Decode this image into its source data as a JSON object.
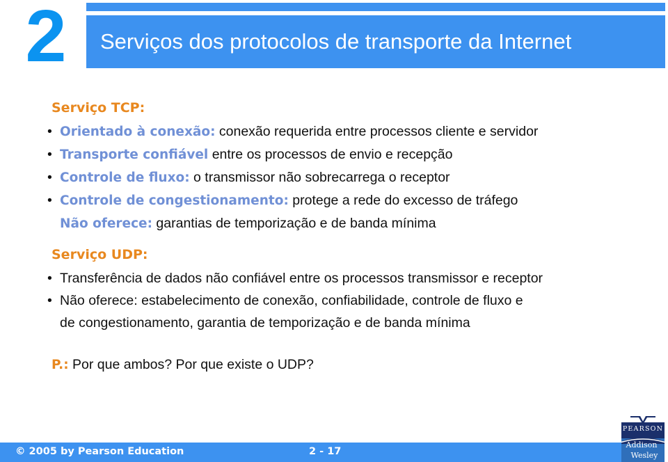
{
  "slide": {
    "chapter_number": "2",
    "title": "Serviços dos protocolos de transporte da Internet",
    "colors": {
      "banner_blue": "#3d92f0",
      "number_blue": "#0b93f0",
      "heading_orange": "#e8881f",
      "highlight_blue": "#7090d6",
      "body_black": "#101010",
      "logo_navy": "#1b2f6b",
      "logo_blue": "#2f6fba"
    }
  },
  "tcp_section": {
    "heading": "Serviço TCP:",
    "bullets": [
      {
        "marker": "•",
        "highlight": "Orientado à conexão:",
        "text": " conexão requerida entre processos cliente e servidor"
      },
      {
        "marker": "•",
        "highlight": "Transporte confiável",
        "text": " entre os processos de envio e recepção"
      },
      {
        "marker": "•",
        "highlight": "Controle de fluxo:",
        "text": " o transmissor não sobrecarrega o receptor"
      },
      {
        "marker": "•",
        "highlight": "Controle de congestionamento:",
        "text": " protege a rede do excesso de tráfego"
      }
    ],
    "subline": {
      "highlight": "Não oferece:",
      "text": " garantias de temporização e de banda mínima"
    }
  },
  "udp_section": {
    "heading": "Serviço UDP:",
    "bullets": [
      {
        "marker": "•",
        "text": "Transferência de dados não confiável entre os processos transmissor e receptor"
      },
      {
        "marker": "•",
        "text": "Não oferece: estabelecimento de conexão, confiabilidade, controle de fluxo e"
      }
    ],
    "continuation": "de congestionamento, garantia de temporização e de banda mínima"
  },
  "question": {
    "tag": "P.:",
    "text": " Por que ambos? Por que existe o UDP?"
  },
  "footer": {
    "copyright": "© 2005 by Pearson Education",
    "page_number": "2 - 17"
  },
  "logo": {
    "brand": "PEARSON",
    "imprint_line1": "Addison",
    "imprint_line2": "Wesley"
  }
}
